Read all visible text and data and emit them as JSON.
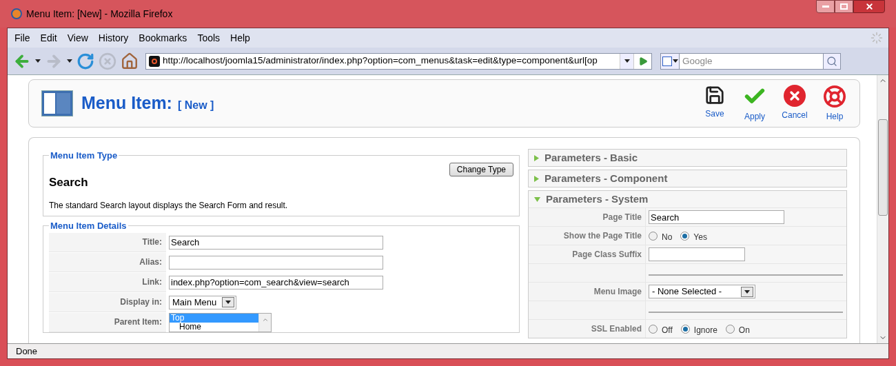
{
  "window": {
    "title": "Menu Item: [New] - Mozilla Firefox"
  },
  "menu_bar": {
    "items": [
      {
        "label": "File"
      },
      {
        "label": "Edit"
      },
      {
        "label": "View"
      },
      {
        "label": "History"
      },
      {
        "label": "Bookmarks"
      },
      {
        "label": "Tools"
      },
      {
        "label": "Help"
      }
    ]
  },
  "nav_bar": {
    "url": "http://localhost/joomla15/administrator/index.php?option=com_menus&task=edit&type=component&url[op",
    "search": {
      "placeholder": "Google"
    }
  },
  "page_header": {
    "title": "Menu Item:",
    "subtitle": "[ New ]",
    "actions": [
      {
        "kind": "save",
        "label": "Save"
      },
      {
        "kind": "apply",
        "label": "Apply"
      },
      {
        "kind": "cancel",
        "label": "Cancel"
      },
      {
        "kind": "help",
        "label": "Help"
      }
    ]
  },
  "menu_item_type": {
    "legend": "Menu Item Type",
    "button": "Change Type",
    "name": "Search",
    "description": "The standard Search layout displays the Search Form and result."
  },
  "menu_item_details": {
    "legend": "Menu Item Details",
    "rows": [
      {
        "label": "Title:",
        "kind": "text",
        "value": "Search"
      },
      {
        "label": "Alias:",
        "kind": "text",
        "value": ""
      },
      {
        "label": "Link:",
        "kind": "text",
        "value": "index.php?option=com_search&view=search"
      },
      {
        "label": "Display in:",
        "kind": "select",
        "value": "Main Menu"
      },
      {
        "label": "Parent Item:",
        "kind": "list",
        "options": [
          {
            "label": "Top",
            "selected": true
          },
          {
            "label": "Home",
            "selected": false
          }
        ]
      }
    ]
  },
  "parameters": {
    "panels": [
      {
        "title": "Parameters - Basic",
        "expanded": false
      },
      {
        "title": "Parameters - Component",
        "expanded": false
      },
      {
        "title": "Parameters - System",
        "expanded": true
      }
    ],
    "rows": [
      {
        "kind": "text",
        "label": "Page Title",
        "value": "Search"
      },
      {
        "kind": "radio",
        "label": "Show the Page Title",
        "options": [
          {
            "label": "No",
            "selected": false
          },
          {
            "label": "Yes",
            "selected": true
          }
        ]
      },
      {
        "kind": "text",
        "label": "Page Class Suffix",
        "value": ""
      },
      {
        "kind": "separator"
      },
      {
        "kind": "select",
        "label": "Menu Image",
        "value": "- None Selected -"
      },
      {
        "kind": "separator"
      },
      {
        "kind": "radio",
        "label": "SSL Enabled",
        "options": [
          {
            "label": "Off",
            "selected": false
          },
          {
            "label": "Ignore",
            "selected": true
          },
          {
            "label": "On",
            "selected": false
          }
        ]
      }
    ]
  },
  "status_bar": {
    "text": "Done"
  }
}
